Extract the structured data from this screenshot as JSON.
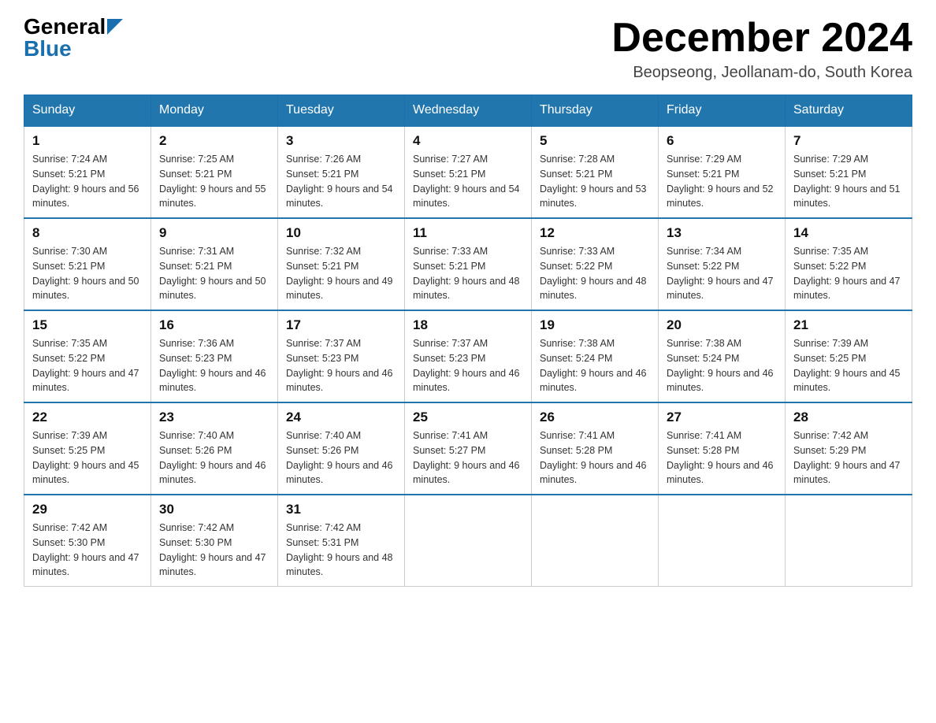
{
  "header": {
    "logo_general": "General",
    "logo_blue": "Blue",
    "month_title": "December 2024",
    "location": "Beopseong, Jeollanam-do, South Korea"
  },
  "weekdays": [
    "Sunday",
    "Monday",
    "Tuesday",
    "Wednesday",
    "Thursday",
    "Friday",
    "Saturday"
  ],
  "weeks": [
    [
      {
        "day": "1",
        "sunrise": "Sunrise: 7:24 AM",
        "sunset": "Sunset: 5:21 PM",
        "daylight": "Daylight: 9 hours and 56 minutes."
      },
      {
        "day": "2",
        "sunrise": "Sunrise: 7:25 AM",
        "sunset": "Sunset: 5:21 PM",
        "daylight": "Daylight: 9 hours and 55 minutes."
      },
      {
        "day": "3",
        "sunrise": "Sunrise: 7:26 AM",
        "sunset": "Sunset: 5:21 PM",
        "daylight": "Daylight: 9 hours and 54 minutes."
      },
      {
        "day": "4",
        "sunrise": "Sunrise: 7:27 AM",
        "sunset": "Sunset: 5:21 PM",
        "daylight": "Daylight: 9 hours and 54 minutes."
      },
      {
        "day": "5",
        "sunrise": "Sunrise: 7:28 AM",
        "sunset": "Sunset: 5:21 PM",
        "daylight": "Daylight: 9 hours and 53 minutes."
      },
      {
        "day": "6",
        "sunrise": "Sunrise: 7:29 AM",
        "sunset": "Sunset: 5:21 PM",
        "daylight": "Daylight: 9 hours and 52 minutes."
      },
      {
        "day": "7",
        "sunrise": "Sunrise: 7:29 AM",
        "sunset": "Sunset: 5:21 PM",
        "daylight": "Daylight: 9 hours and 51 minutes."
      }
    ],
    [
      {
        "day": "8",
        "sunrise": "Sunrise: 7:30 AM",
        "sunset": "Sunset: 5:21 PM",
        "daylight": "Daylight: 9 hours and 50 minutes."
      },
      {
        "day": "9",
        "sunrise": "Sunrise: 7:31 AM",
        "sunset": "Sunset: 5:21 PM",
        "daylight": "Daylight: 9 hours and 50 minutes."
      },
      {
        "day": "10",
        "sunrise": "Sunrise: 7:32 AM",
        "sunset": "Sunset: 5:21 PM",
        "daylight": "Daylight: 9 hours and 49 minutes."
      },
      {
        "day": "11",
        "sunrise": "Sunrise: 7:33 AM",
        "sunset": "Sunset: 5:21 PM",
        "daylight": "Daylight: 9 hours and 48 minutes."
      },
      {
        "day": "12",
        "sunrise": "Sunrise: 7:33 AM",
        "sunset": "Sunset: 5:22 PM",
        "daylight": "Daylight: 9 hours and 48 minutes."
      },
      {
        "day": "13",
        "sunrise": "Sunrise: 7:34 AM",
        "sunset": "Sunset: 5:22 PM",
        "daylight": "Daylight: 9 hours and 47 minutes."
      },
      {
        "day": "14",
        "sunrise": "Sunrise: 7:35 AM",
        "sunset": "Sunset: 5:22 PM",
        "daylight": "Daylight: 9 hours and 47 minutes."
      }
    ],
    [
      {
        "day": "15",
        "sunrise": "Sunrise: 7:35 AM",
        "sunset": "Sunset: 5:22 PM",
        "daylight": "Daylight: 9 hours and 47 minutes."
      },
      {
        "day": "16",
        "sunrise": "Sunrise: 7:36 AM",
        "sunset": "Sunset: 5:23 PM",
        "daylight": "Daylight: 9 hours and 46 minutes."
      },
      {
        "day": "17",
        "sunrise": "Sunrise: 7:37 AM",
        "sunset": "Sunset: 5:23 PM",
        "daylight": "Daylight: 9 hours and 46 minutes."
      },
      {
        "day": "18",
        "sunrise": "Sunrise: 7:37 AM",
        "sunset": "Sunset: 5:23 PM",
        "daylight": "Daylight: 9 hours and 46 minutes."
      },
      {
        "day": "19",
        "sunrise": "Sunrise: 7:38 AM",
        "sunset": "Sunset: 5:24 PM",
        "daylight": "Daylight: 9 hours and 46 minutes."
      },
      {
        "day": "20",
        "sunrise": "Sunrise: 7:38 AM",
        "sunset": "Sunset: 5:24 PM",
        "daylight": "Daylight: 9 hours and 46 minutes."
      },
      {
        "day": "21",
        "sunrise": "Sunrise: 7:39 AM",
        "sunset": "Sunset: 5:25 PM",
        "daylight": "Daylight: 9 hours and 45 minutes."
      }
    ],
    [
      {
        "day": "22",
        "sunrise": "Sunrise: 7:39 AM",
        "sunset": "Sunset: 5:25 PM",
        "daylight": "Daylight: 9 hours and 45 minutes."
      },
      {
        "day": "23",
        "sunrise": "Sunrise: 7:40 AM",
        "sunset": "Sunset: 5:26 PM",
        "daylight": "Daylight: 9 hours and 46 minutes."
      },
      {
        "day": "24",
        "sunrise": "Sunrise: 7:40 AM",
        "sunset": "Sunset: 5:26 PM",
        "daylight": "Daylight: 9 hours and 46 minutes."
      },
      {
        "day": "25",
        "sunrise": "Sunrise: 7:41 AM",
        "sunset": "Sunset: 5:27 PM",
        "daylight": "Daylight: 9 hours and 46 minutes."
      },
      {
        "day": "26",
        "sunrise": "Sunrise: 7:41 AM",
        "sunset": "Sunset: 5:28 PM",
        "daylight": "Daylight: 9 hours and 46 minutes."
      },
      {
        "day": "27",
        "sunrise": "Sunrise: 7:41 AM",
        "sunset": "Sunset: 5:28 PM",
        "daylight": "Daylight: 9 hours and 46 minutes."
      },
      {
        "day": "28",
        "sunrise": "Sunrise: 7:42 AM",
        "sunset": "Sunset: 5:29 PM",
        "daylight": "Daylight: 9 hours and 47 minutes."
      }
    ],
    [
      {
        "day": "29",
        "sunrise": "Sunrise: 7:42 AM",
        "sunset": "Sunset: 5:30 PM",
        "daylight": "Daylight: 9 hours and 47 minutes."
      },
      {
        "day": "30",
        "sunrise": "Sunrise: 7:42 AM",
        "sunset": "Sunset: 5:30 PM",
        "daylight": "Daylight: 9 hours and 47 minutes."
      },
      {
        "day": "31",
        "sunrise": "Sunrise: 7:42 AM",
        "sunset": "Sunset: 5:31 PM",
        "daylight": "Daylight: 9 hours and 48 minutes."
      },
      null,
      null,
      null,
      null
    ]
  ]
}
